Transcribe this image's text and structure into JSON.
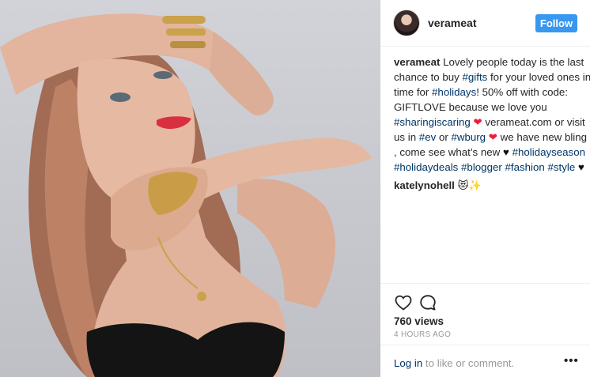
{
  "post": {
    "username": "verameat",
    "follow_label": "Follow",
    "caption": {
      "username": "verameat",
      "lines": [
        [
          {
            "t": "Lovely people today is the last",
            "k": "text"
          }
        ],
        [
          {
            "t": "chance to buy ",
            "k": "text"
          },
          {
            "t": "#gifts",
            "k": "tag"
          },
          {
            "t": " for your loved ones in",
            "k": "text"
          }
        ],
        [
          {
            "t": "time for ",
            "k": "text"
          },
          {
            "t": "#holidays",
            "k": "tag"
          },
          {
            "t": "! 50% off with code:",
            "k": "text"
          }
        ],
        [
          {
            "t": "GIFTLOVE because we love you",
            "k": "text"
          }
        ],
        [
          {
            "t": "#sharingiscaring",
            "k": "tag"
          },
          {
            "t": " ",
            "k": "text"
          },
          {
            "t": "❤",
            "k": "heart-red"
          },
          {
            "t": " verameat.com or visit",
            "k": "text"
          }
        ],
        [
          {
            "t": "us in ",
            "k": "text"
          },
          {
            "t": "#ev",
            "k": "tag"
          },
          {
            "t": " or ",
            "k": "text"
          },
          {
            "t": "#wburg",
            "k": "tag"
          },
          {
            "t": " ",
            "k": "text"
          },
          {
            "t": "❤",
            "k": "heart-red"
          },
          {
            "t": " we have new bling",
            "k": "text"
          }
        ],
        [
          {
            "t": ", come see what’s new ",
            "k": "text"
          },
          {
            "t": "♥",
            "k": "heart-black"
          },
          {
            "t": " ",
            "k": "text"
          },
          {
            "t": "#holidayseason",
            "k": "tag"
          }
        ],
        [
          {
            "t": "#holidaydeals",
            "k": "tag"
          },
          {
            "t": " ",
            "k": "text"
          },
          {
            "t": "#blogger",
            "k": "tag"
          },
          {
            "t": " ",
            "k": "text"
          },
          {
            "t": "#fashion",
            "k": "tag"
          },
          {
            "t": " ",
            "k": "text"
          },
          {
            "t": "#style",
            "k": "tag"
          },
          {
            "t": " ",
            "k": "text"
          },
          {
            "t": "♥",
            "k": "heart-black"
          }
        ]
      ]
    },
    "comment": {
      "username": "katelynohell",
      "text": "😻✨"
    },
    "views": "760 views",
    "time": "4 HOURS AGO",
    "footer": {
      "login_link": "Log in",
      "login_rest": " to like or comment.",
      "more": "•••"
    },
    "icons": {
      "like": "heart-outline-icon",
      "comment": "speech-bubble-icon",
      "more": "more-options-icon"
    },
    "colors": {
      "follow_button": "#3897f0",
      "link": "#003569",
      "muted": "#999999"
    }
  }
}
